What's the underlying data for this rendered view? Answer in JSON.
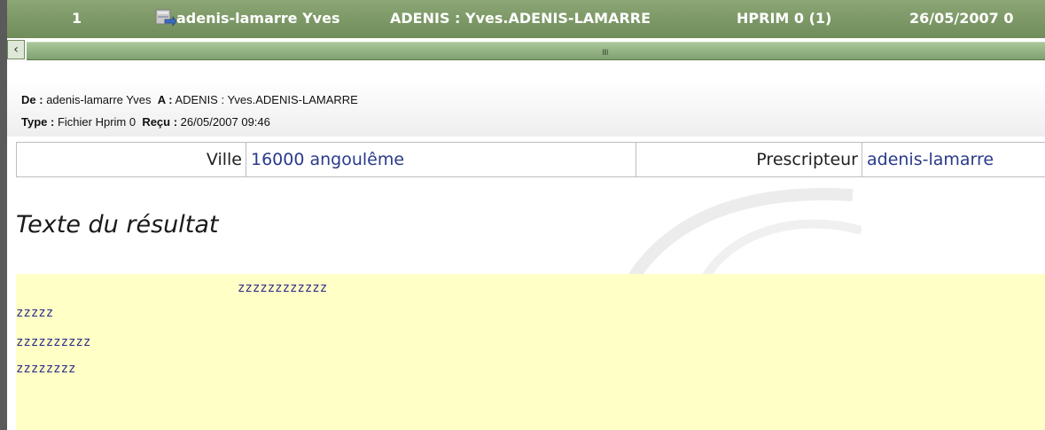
{
  "header_row": {
    "index": "1",
    "from_name": "adenis-lamarre Yves",
    "recipient": "ADENIS : Yves.ADENIS-LAMARRE",
    "type": "HPRIM 0 (1)",
    "date": "26/05/2007 0"
  },
  "scrollbar": {
    "left_arrow_icon": "chevron-left-icon",
    "grip": "IIII"
  },
  "message": {
    "from_label": "De :",
    "from_value": "adenis-lamarre Yves",
    "to_label": "A :",
    "to_value": "ADENIS : Yves.ADENIS-LAMARRE",
    "type_label": "Type :",
    "type_value": "Fichier Hprim 0",
    "received_label": "Reçu :",
    "received_value": "26/05/2007 09:46"
  },
  "fields": {
    "city_label": "Ville",
    "city_value": "16000 angoulême",
    "prescriber_label": "Prescripteur",
    "prescriber_value": "adenis-lamarre"
  },
  "result": {
    "title": "Texte du résultat",
    "lines": [
      "zzzzzzzzzzzz",
      "zzzzz",
      "zzzzzzzzzz",
      "zzzzzzzz"
    ]
  },
  "colors": {
    "header_green": "#7a9766",
    "text_blue": "#2a3a8a",
    "result_bg": "#ffffc6"
  }
}
